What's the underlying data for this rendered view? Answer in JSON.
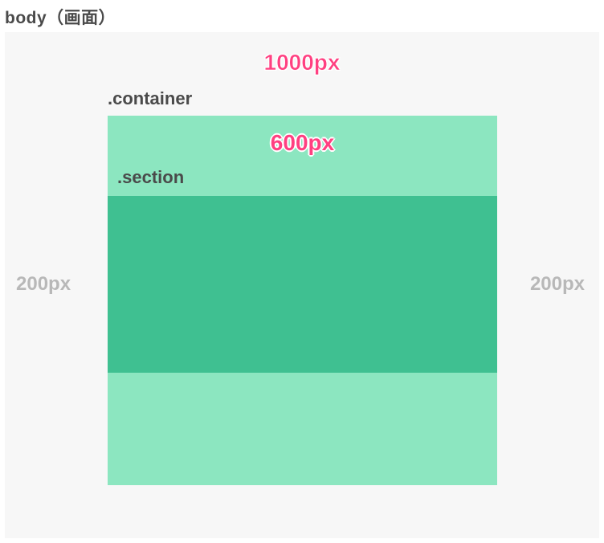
{
  "title": "body（画面）",
  "outerWidth": "1000px",
  "containerLabel": ".container",
  "innerWidth": "600px",
  "sectionLabel": ".section",
  "leftMargin": "200px",
  "rightMargin": "200px"
}
